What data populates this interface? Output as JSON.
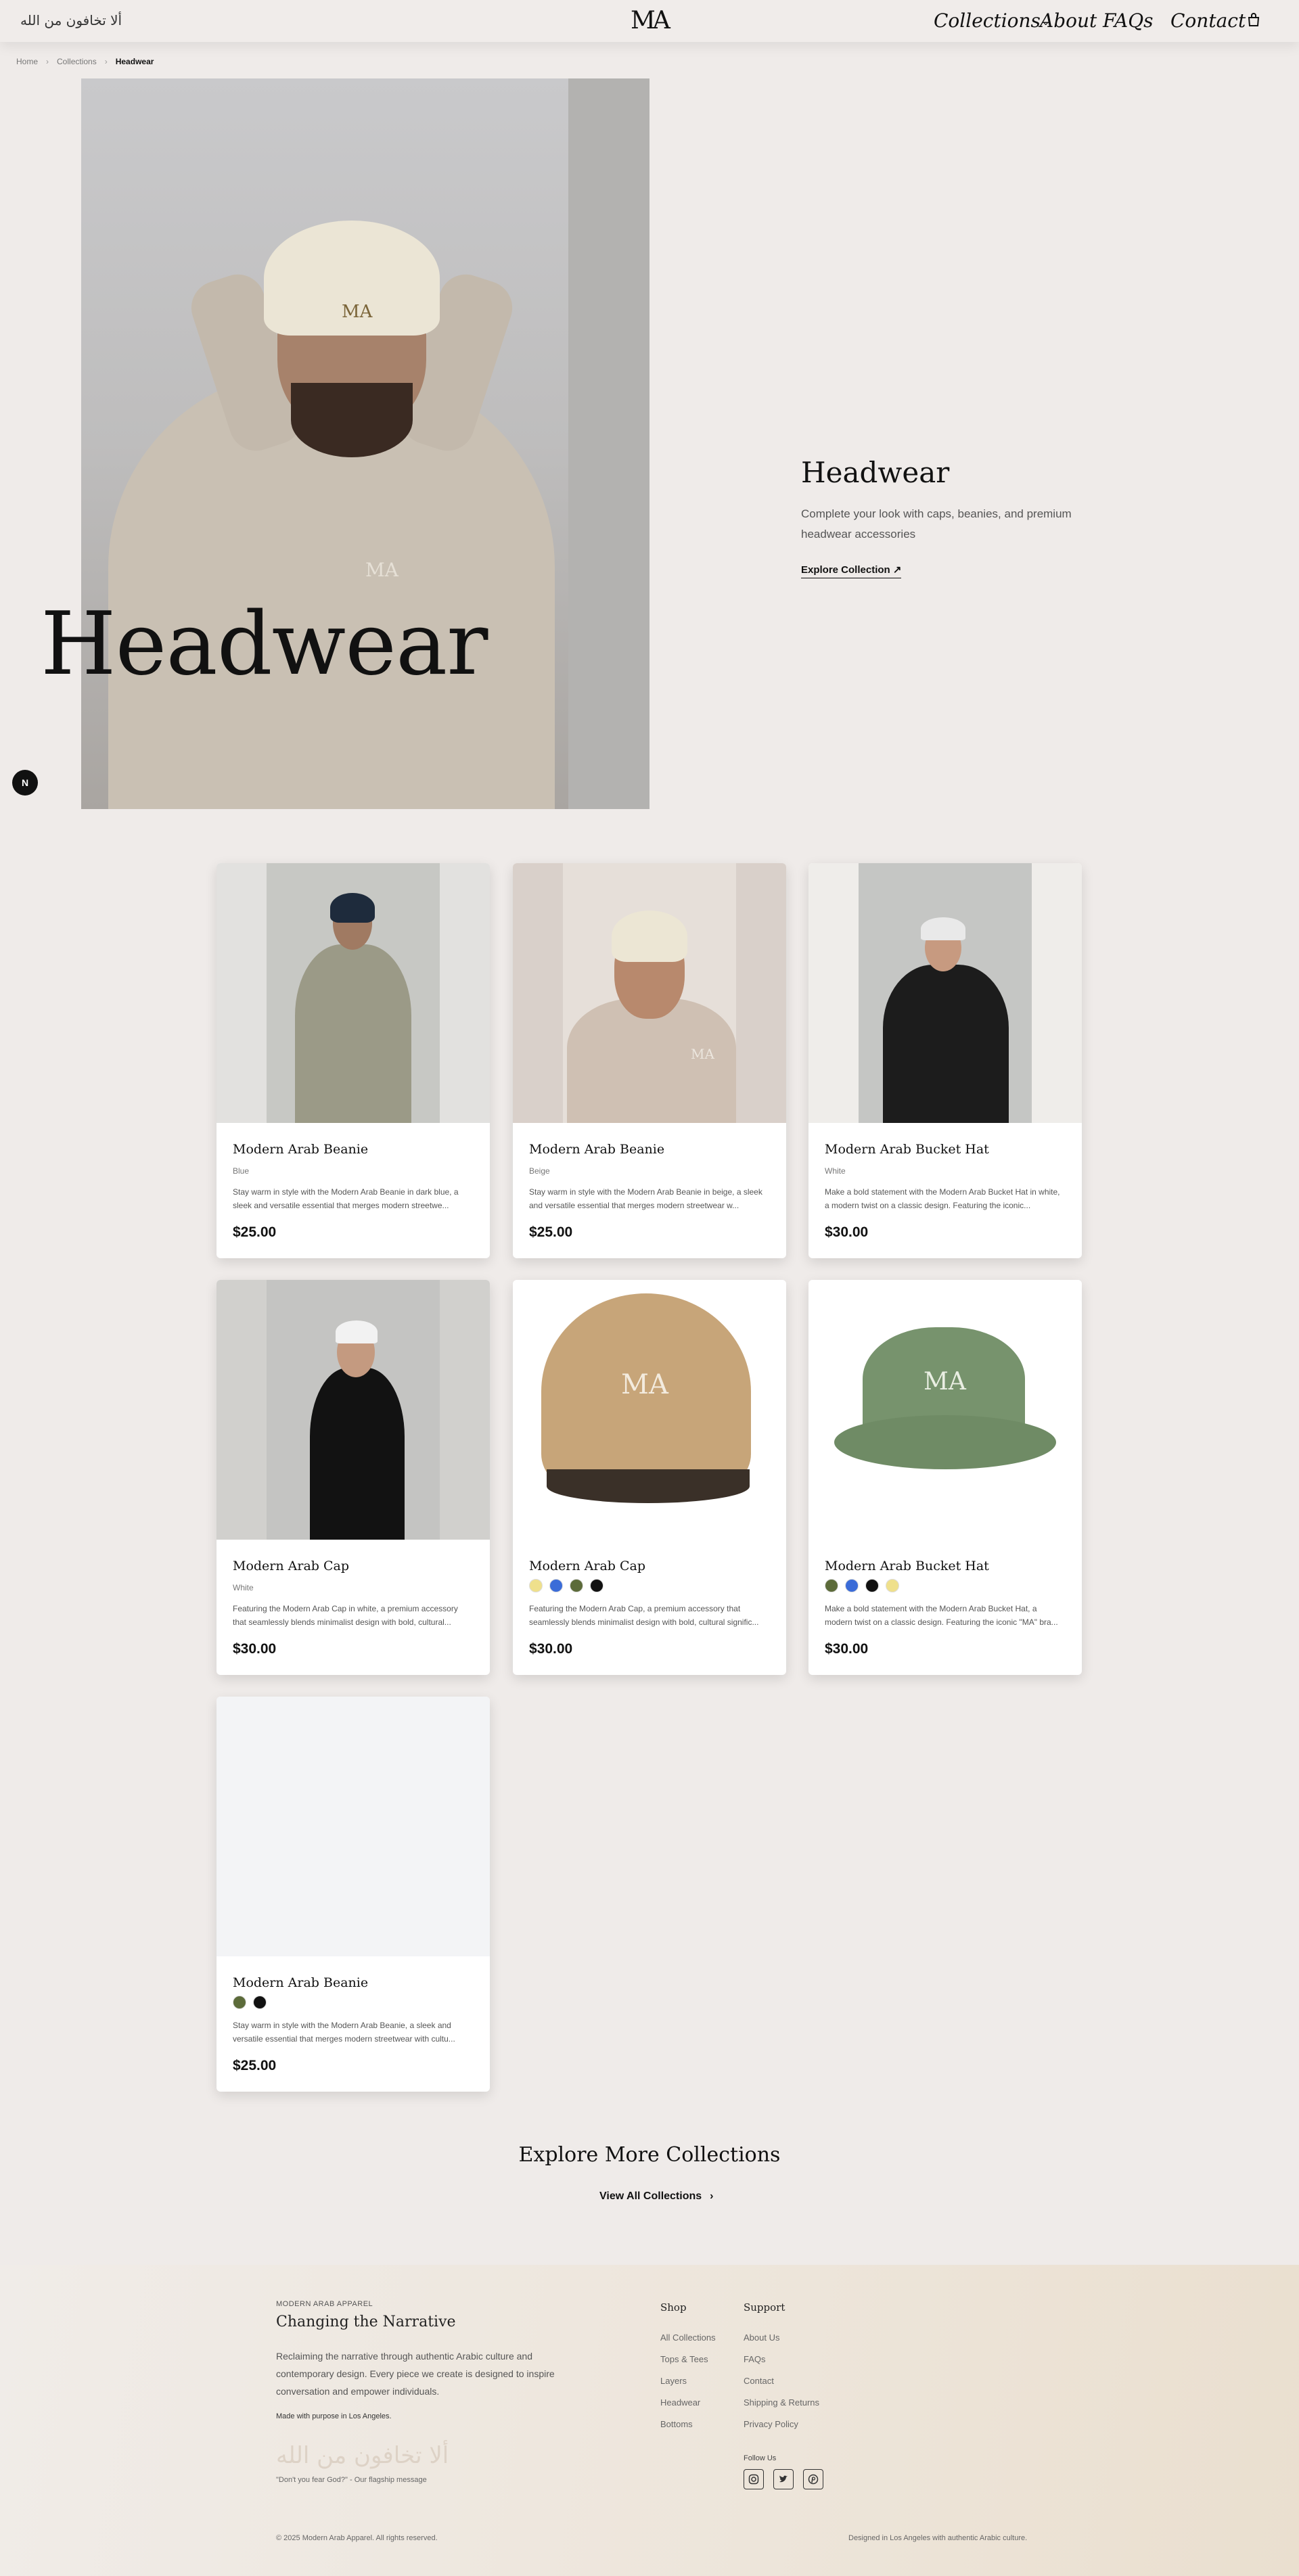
{
  "header": {
    "arabic_phrase": "ألا تخافون من الله",
    "logo": "MA",
    "nav": {
      "collections": "Collections",
      "about": "About",
      "faq": "FAQs",
      "contact": "Contact"
    }
  },
  "breadcrumb": {
    "home": "Home",
    "collections": "Collections",
    "current": "Headwear"
  },
  "hero": {
    "big_title": "Headwear",
    "badge": "N",
    "title": "Headwear",
    "description": "Complete your look with caps, beanies, and premium headwear accessories",
    "cta": "Explore Collection"
  },
  "products": [
    {
      "name": "Modern Arab Beanie",
      "color": "Blue",
      "description": "Stay warm in style with the Modern Arab Beanie in dark blue, a sleek and versatile essential that merges modern streetwe...",
      "price": "$25.00"
    },
    {
      "name": "Modern Arab Beanie",
      "color": "Beige",
      "description": "Stay warm in style with the Modern Arab Beanie in beige, a sleek and versatile essential that merges modern streetwear w...",
      "price": "$25.00"
    },
    {
      "name": "Modern Arab Bucket Hat",
      "color": "White",
      "description": "Make a bold statement with the Modern Arab Bucket Hat in white, a modern twist on a classic design. Featuring the iconic...",
      "price": "$30.00"
    },
    {
      "name": "Modern Arab Cap",
      "color": "White",
      "description": "Featuring the Modern Arab Cap in white, a premium accessory that seamlessly blends minimalist design with bold, cultural...",
      "price": "$30.00"
    },
    {
      "name": "Modern Arab Cap",
      "swatches": [
        "#efe08c",
        "#3b6cd8",
        "#5c6b3a",
        "#111111"
      ],
      "description": "Featuring the Modern Arab Cap, a premium accessory that seamlessly blends minimalist design with bold, cultural signific...",
      "price": "$30.00"
    },
    {
      "name": "Modern Arab Bucket Hat",
      "swatches": [
        "#5c6b3a",
        "#3b6cd8",
        "#111111",
        "#efe08c"
      ],
      "description": "Make a bold statement with the Modern Arab Bucket Hat, a modern twist on a classic design. Featuring the iconic \"MA\" bra...",
      "price": "$30.00"
    },
    {
      "name": "Modern Arab Beanie",
      "swatches": [
        "#5c6b3a",
        "#111111"
      ],
      "description": "Stay warm in style with the Modern Arab Beanie, a sleek and versatile essential that merges modern streetwear with cultu...",
      "price": "$25.00"
    }
  ],
  "product_logo": "MA",
  "explore_more": {
    "title": "Explore More Collections",
    "link": "View All Collections"
  },
  "footer": {
    "brand": "MODERN ARAB APPAREL",
    "tagline": "Changing the Narrative",
    "description": "Reclaiming the narrative through authentic Arabic culture and contemporary design. Every piece we create is designed to inspire conversation and empower individuals.",
    "made": "Made with purpose in Los Angeles.",
    "arabic": "ألا تخافون من الله",
    "quote": "\"Don't you fear God?\" - Our flagship message",
    "shop_title": "Shop",
    "shop_links": [
      "All Collections",
      "Tops & Tees",
      "Layers",
      "Headwear",
      "Bottoms"
    ],
    "support_title": "Support",
    "support_links": [
      "About Us",
      "FAQs",
      "Contact",
      "Shipping & Returns",
      "Privacy Policy"
    ],
    "follow": "Follow Us",
    "copyright": "© 2025 Modern Arab Apparel. All rights reserved.",
    "designed": "Designed in Los Angeles with authentic Arabic culture."
  }
}
